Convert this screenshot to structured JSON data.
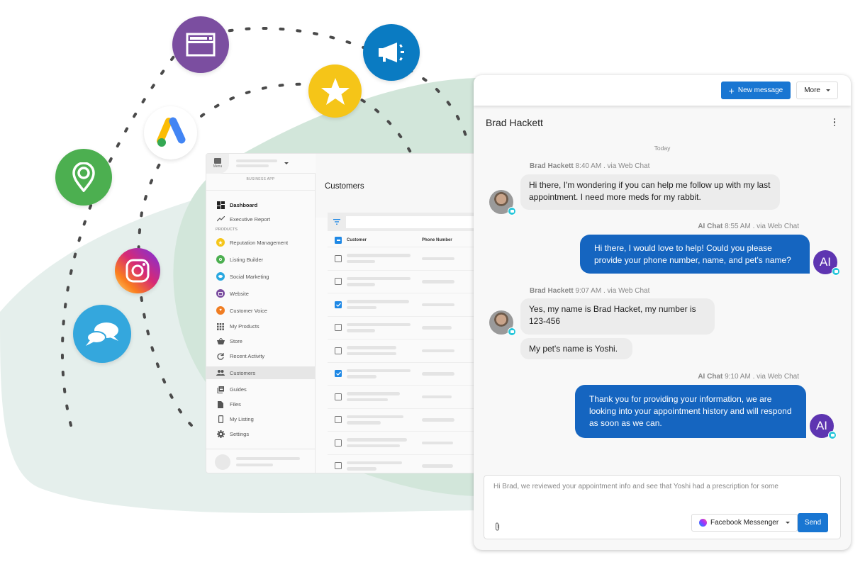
{
  "business_app": {
    "menu_label": "Menu",
    "brand_label": "BUSINESS APP",
    "nav_top": [
      {
        "label": "Dashboard",
        "icon": "dashboard-icon"
      },
      {
        "label": "Executive Report",
        "icon": "trending-icon"
      }
    ],
    "products_label": "PRODUCTS",
    "products": [
      {
        "label": "Reputation Management",
        "icon": "star-icon",
        "color": "#f5c518"
      },
      {
        "label": "Listing Builder",
        "icon": "location-pin-icon",
        "color": "#4caf50"
      },
      {
        "label": "Social Marketing",
        "icon": "chat-bubbles-icon",
        "color": "#29a8e0"
      },
      {
        "label": "Website",
        "icon": "browser-window-icon",
        "color": "#7b4ea0"
      },
      {
        "label": "Customer Voice",
        "icon": "heart-icon",
        "color": "#f07d22"
      }
    ],
    "nav_more": [
      {
        "label": "My Products",
        "icon": "grid-icon"
      },
      {
        "label": "Store",
        "icon": "basket-icon"
      },
      {
        "label": "Recent Activity",
        "icon": "refresh-icon"
      },
      {
        "label": "Customers",
        "icon": "people-icon",
        "active": true
      },
      {
        "label": "Guides",
        "icon": "library-books-icon"
      },
      {
        "label": "Files",
        "icon": "file-icon"
      },
      {
        "label": "My Listing",
        "icon": "phone-icon"
      },
      {
        "label": "Settings",
        "icon": "gear-icon"
      }
    ],
    "page_title": "Customers",
    "table": {
      "columns": [
        "Customer",
        "Phone Number"
      ],
      "rows_checked": [
        false,
        false,
        true,
        false,
        false,
        true,
        false,
        false,
        false,
        false
      ]
    }
  },
  "floating_icons": [
    {
      "name": "website",
      "color": "#7b4ea0"
    },
    {
      "name": "megaphone",
      "color": "#0a7bc2"
    },
    {
      "name": "reputation-star",
      "color": "#f5c518"
    },
    {
      "name": "google-ads",
      "color": "#ffffff"
    },
    {
      "name": "listing-pin",
      "color": "#4caf50"
    },
    {
      "name": "instagram",
      "color": "#d62976"
    },
    {
      "name": "social-chat",
      "color": "#34a7dd"
    }
  ],
  "chat": {
    "new_message_label": "New message",
    "more_label": "More",
    "contact_name": "Brad Hackett",
    "day_label": "Today",
    "messages": [
      {
        "sender": "Brad Hackett",
        "time": "8:40 AM",
        "via": ". via Web Chat",
        "direction": "in",
        "text": "Hi there, I'm wondering if you can help me follow up with my last appointment. I need more meds for my rabbit."
      },
      {
        "sender": "AI Chat",
        "time": "8:55 AM",
        "via": ". via Web Chat",
        "direction": "out",
        "text": "Hi there, I would love to help! Could you please provide your phone number, name, and pet's name?"
      },
      {
        "sender": "Brad Hackett",
        "time": "9:07 AM",
        "via": ". via Web Chat",
        "direction": "in",
        "text": "Yes, my name is Brad Hacket, my number is 123-456",
        "text2": "My pet's name is Yoshi."
      },
      {
        "sender": "AI Chat",
        "time": "9:10 AM",
        "via": ". via Web Chat",
        "direction": "out",
        "text": "Thank you for providing your information, we are looking into your appointment history and will respond as soon as we can."
      }
    ],
    "ai_avatar_label": "AI",
    "composer_text": "Hi Brad, we reviewed your appointment info and see that Yoshi had a prescription for some",
    "channel_label": "Facebook Messenger",
    "send_label": "Send"
  }
}
